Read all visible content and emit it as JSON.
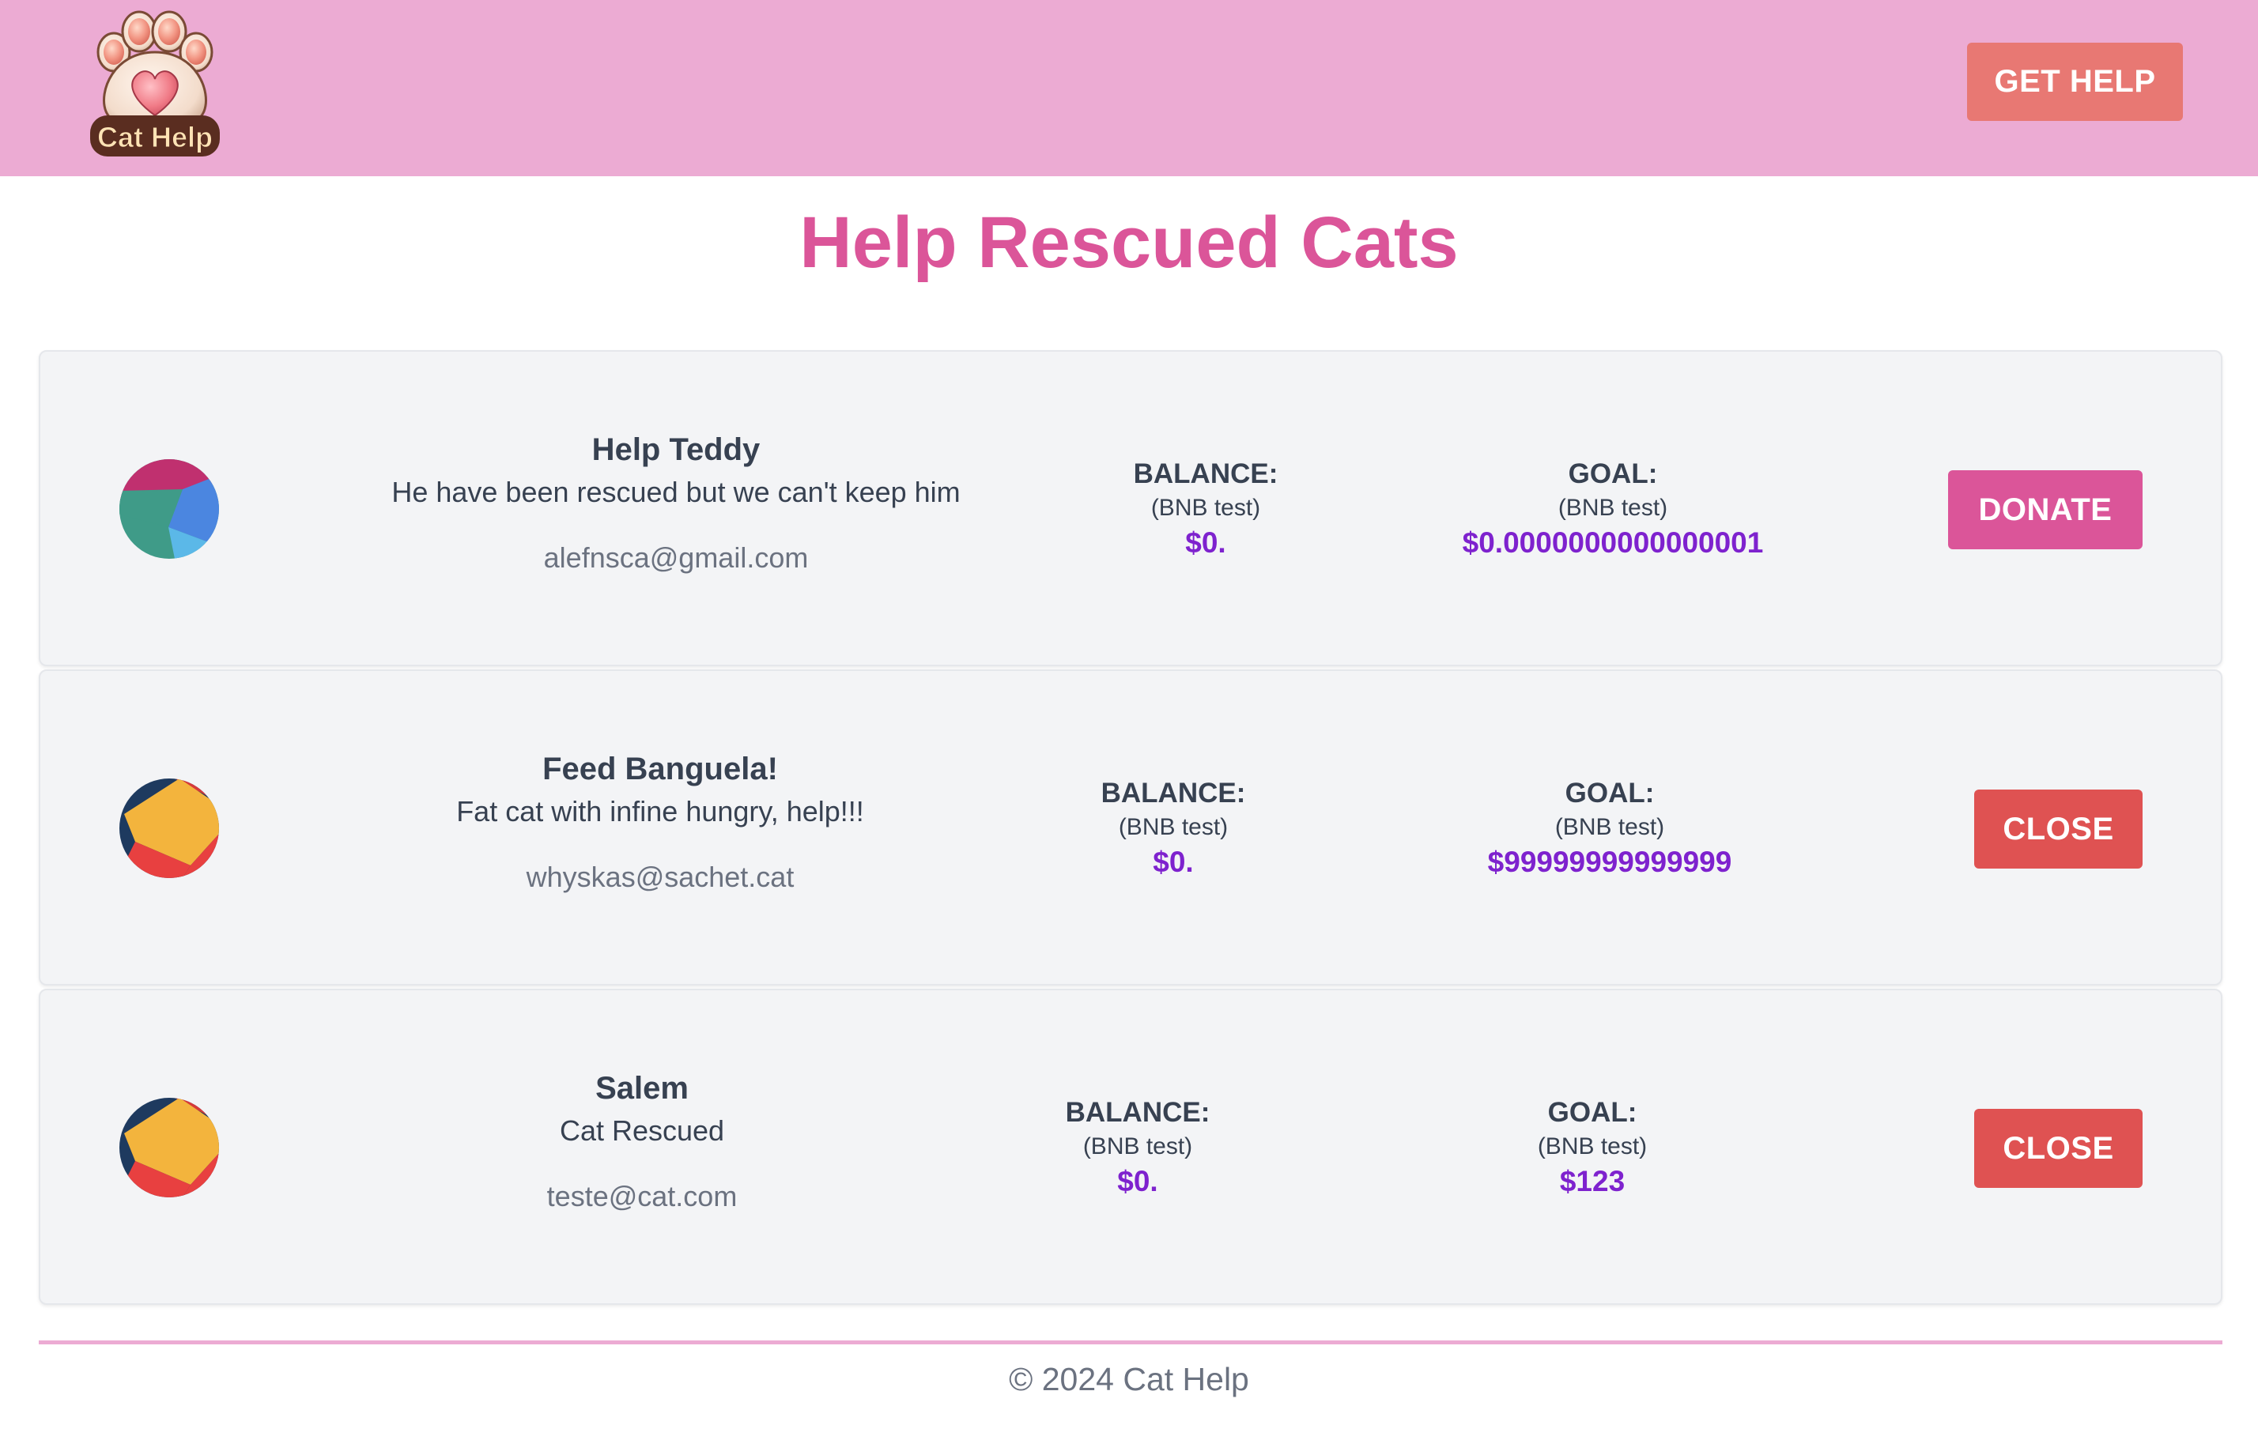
{
  "header": {
    "logo_text": "Cat Help",
    "get_help_label": "GET HELP"
  },
  "page_title": "Help Rescued Cats",
  "campaigns": [
    {
      "name": "Help Teddy",
      "description": "He have been rescued but we can't keep him",
      "email": "alefnsca@gmail.com",
      "balance_label": "BALANCE:",
      "balance_network": "(BNB test)",
      "balance_value": "$0.",
      "goal_label": "GOAL:",
      "goal_network": "(BNB test)",
      "goal_value": "$0.0000000000000001",
      "action_label": "DONATE",
      "avatar_icon": "abstract-avatar-icon"
    },
    {
      "name": "Feed Banguela!",
      "description": "Fat cat with infine hungry, help!!!",
      "email": "whyskas@sachet.cat",
      "balance_label": "BALANCE:",
      "balance_network": "(BNB test)",
      "balance_value": "$0.",
      "goal_label": "GOAL:",
      "goal_network": "(BNB test)",
      "goal_value": "$99999999999999",
      "action_label": "CLOSE",
      "avatar_icon": "abstract-avatar-icon"
    },
    {
      "name": "Salem",
      "description": "Cat Rescued",
      "email": "teste@cat.com",
      "balance_label": "BALANCE:",
      "balance_network": "(BNB test)",
      "balance_value": "$0.",
      "goal_label": "GOAL:",
      "goal_network": "(BNB test)",
      "goal_value": "$123",
      "action_label": "CLOSE",
      "avatar_icon": "abstract-avatar-icon"
    }
  ],
  "footer": {
    "copyright": "© 2024 Cat Help"
  },
  "colors": {
    "header_bg": "#ecabd3",
    "title": "#db5599",
    "donate": "#db5599",
    "close": "#df5252",
    "get_help": "#e87873",
    "amount": "#7e22ce",
    "card_bg": "#f3f4f6"
  }
}
